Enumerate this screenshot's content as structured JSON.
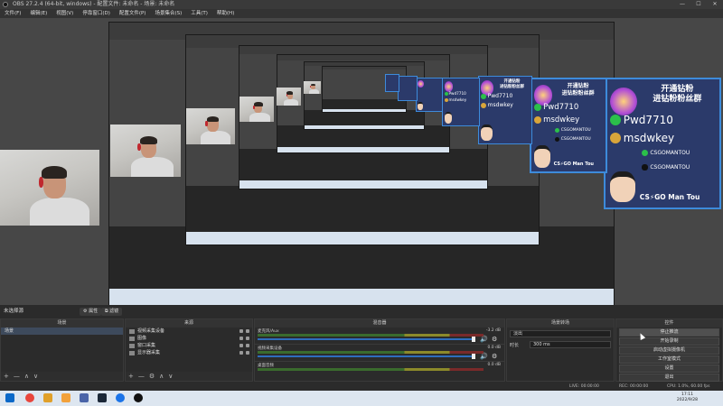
{
  "window": {
    "title": "OBS 27.2.4 (64-bit, windows) - 配置文件: 未命名 - 场景: 未命名",
    "minimize": "—",
    "maximize": "☐",
    "close": "✕"
  },
  "menu": [
    "文件(F)",
    "编辑(E)",
    "视图(V)",
    "停靠窗口(D)",
    "配置文件(P)",
    "场景集合(S)",
    "工具(T)",
    "帮助(H)"
  ],
  "promo": {
    "line1": "开通钻粉",
    "line2": "进钻粉粉丝群",
    "wechat": "Pwd7710",
    "qq": "msdwkey",
    "social1": "CSGOMANTOU",
    "social2": "CSGOMANTOU",
    "bottom": "CS⚡GO Man Tou",
    "colors": {
      "bg": "#2b3a6a",
      "border": "#3d8bdb"
    }
  },
  "scene_bar": {
    "label": "未选择源",
    "properties": "⚙ 属性",
    "filters": "⧉ 滤镜"
  },
  "docks": {
    "scenes": {
      "title": "场景",
      "items": [
        "场景"
      ]
    },
    "sources": {
      "title": "来源",
      "items": [
        "视频采集设备",
        "图像",
        "窗口采集",
        "显示器采集"
      ]
    },
    "mixer": {
      "title": "混音器",
      "tracks": [
        {
          "name": "麦克风/Aux",
          "db": "-3.2 dB"
        },
        {
          "name": "视频采集设备",
          "db": "0.0 dB"
        },
        {
          "name": "桌面音频",
          "db": "0.0 dB"
        }
      ]
    },
    "transitions": {
      "title": "场景转场",
      "type": "淡出",
      "duration_label": "时长",
      "duration_value": "300 ms"
    },
    "controls": {
      "title": "控件",
      "buttons": [
        "停止推流",
        "开始录制",
        "启动虚拟摄像机",
        "工作室模式",
        "设置",
        "退出"
      ]
    }
  },
  "footer_icons": {
    "add": "+",
    "remove": "—",
    "up": "∧",
    "down": "∨",
    "gear": "⚙"
  },
  "status": {
    "live": "LIVE: 00:00:00",
    "rec": "REC: 00:00:00",
    "cpu": "CPU: 1.0%, 60.00 fps"
  },
  "taskbar": {
    "time": "17:11",
    "date": "2022/9/28"
  }
}
